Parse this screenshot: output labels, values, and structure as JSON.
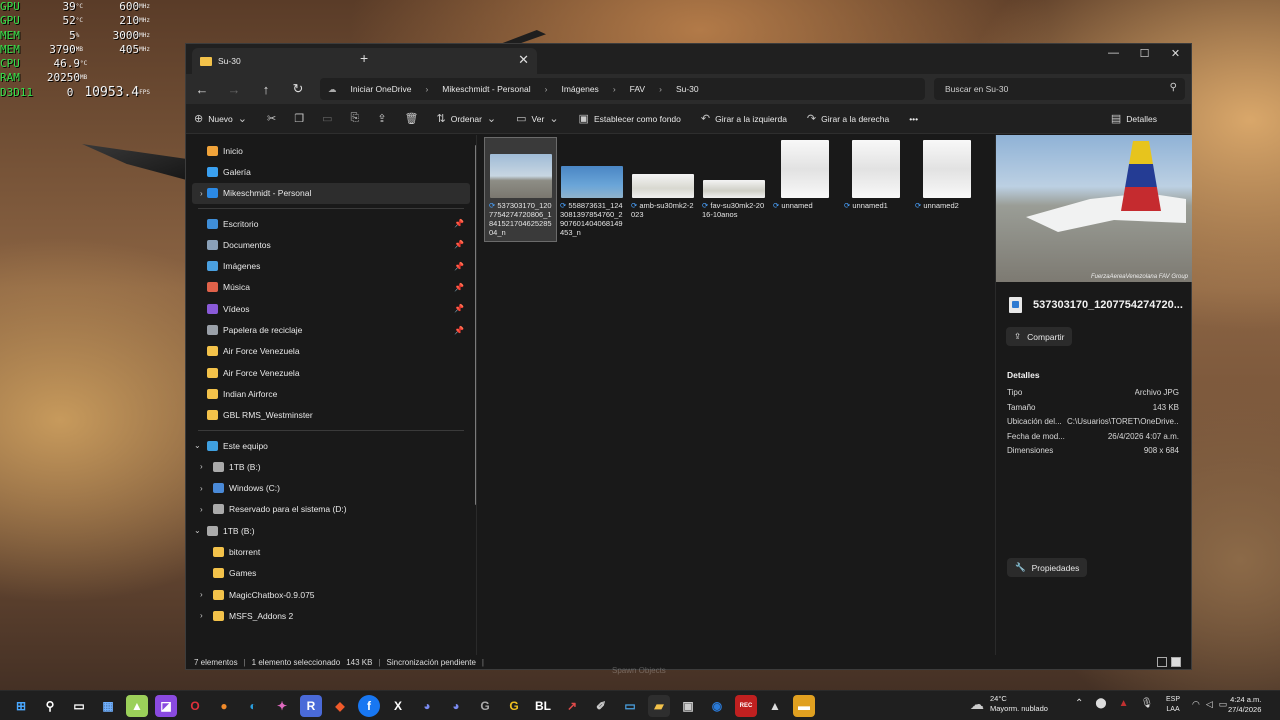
{
  "osd": {
    "rows": [
      {
        "k": "GPU",
        "v1": "39",
        "u1": "°C",
        "v2": "600",
        "u2": "MHz"
      },
      {
        "k": "GPU",
        "v1": "52",
        "u1": "°C",
        "v2": "210",
        "u2": "MHz"
      },
      {
        "k": "MEM",
        "v1": "5",
        "u1": "%",
        "v2": "3000",
        "u2": "MHz"
      },
      {
        "k": "MEM",
        "v1": "3790",
        "u1": "MB",
        "v2": "405",
        "u2": "MHz"
      },
      {
        "k": "CPU",
        "v1": "46.9",
        "u1": "°C",
        "v2": "",
        "u2": ""
      },
      {
        "k": "RAM",
        "v1": "20250",
        "u1": "MB",
        "v2": "",
        "u2": ""
      },
      {
        "k": "D3D11",
        "v1": "0",
        "u1": "",
        "v2": "10953.4",
        "u2": "FPS"
      }
    ]
  },
  "window": {
    "tab_title": "Su-30",
    "tab_close": "✕",
    "new_tab": "+",
    "controls": {
      "minimize": "—",
      "maximize": "☐",
      "close": "✕"
    }
  },
  "address": {
    "back": "←",
    "forward": "→",
    "up": "↑",
    "refresh": "↻",
    "crumbs": [
      "Iniciar OneDrive",
      "Mikeschmidt - Personal",
      "Imágenes",
      "FAV",
      "Su-30"
    ],
    "search_placeholder": "Buscar en Su-30"
  },
  "toolbar": {
    "new": "Nuevo",
    "sort": "Ordenar",
    "view": "Ver",
    "set_background": "Establecer como fondo",
    "rotate_left": "Girar a la izquierda",
    "rotate_right": "Girar a la derecha",
    "more": "•••",
    "details": "Detalles"
  },
  "sidebar": {
    "top": [
      {
        "label": "Inicio",
        "color": "#f0a33a"
      },
      {
        "label": "Galería",
        "color": "#3aa0f0"
      },
      {
        "label": "Mikeschmidt - Personal",
        "color": "#2b8ae6"
      }
    ],
    "quick": [
      {
        "label": "Escritorio",
        "color": "#3f8ed8"
      },
      {
        "label": "Documentos",
        "color": "#8aa0b8"
      },
      {
        "label": "Imágenes",
        "color": "#4aa0e0"
      },
      {
        "label": "Música",
        "color": "#e0624a"
      },
      {
        "label": "Vídeos",
        "color": "#8a5ad8"
      },
      {
        "label": "Papelera de reciclaje",
        "color": "#9aa0a8"
      },
      {
        "label": "Air Force Venezuela",
        "color": "#f3c24a"
      },
      {
        "label": "Air Force Venezuela",
        "color": "#f3c24a"
      },
      {
        "label": "Indian Airforce",
        "color": "#f3c24a"
      },
      {
        "label": "GBL RMS_Westminster",
        "color": "#f3c24a"
      }
    ],
    "tree": [
      {
        "label": "Este equipo",
        "color": "#3fa0e0"
      },
      {
        "label": "1TB (B:)",
        "color": "#aaaaaa"
      },
      {
        "label": "Windows (C:)",
        "color": "#4a8ad8"
      },
      {
        "label": "Reservado para el sistema (D:)",
        "color": "#aaaaaa"
      },
      {
        "label": "1TB (B:)",
        "color": "#aaaaaa"
      },
      {
        "label": "bitorrent",
        "color": "#f3c24a"
      },
      {
        "label": "Games",
        "color": "#f3c24a"
      },
      {
        "label": "MagicChatbox-0.9.075",
        "color": "#f3c24a"
      },
      {
        "label": "MSFS_Addons 2",
        "color": "#f3c24a"
      }
    ]
  },
  "files": [
    {
      "name": "537303170_1207754274720806_184152170462528504_n"
    },
    {
      "name": "558873631_1243081397854760_2907601404068149453_n"
    },
    {
      "name": "amb-su30mk2-2023"
    },
    {
      "name": "fav-su30mk2-2016-10anos"
    },
    {
      "name": "unnamed"
    },
    {
      "name": "unnamed1"
    },
    {
      "name": "unnamed2"
    }
  ],
  "preview": {
    "watermark": "FuerzaAereaVenezolana FAV Group",
    "filename": "537303170_1207754274720...",
    "share": "Compartir",
    "details_title": "Detalles",
    "rows": [
      {
        "k": "Tipo",
        "v": "Archivo JPG"
      },
      {
        "k": "Tamaño",
        "v": "143 KB"
      },
      {
        "k": "Ubicación del...",
        "v": "C:\\Usuarios\\TORET\\OneDrive..."
      },
      {
        "k": "Fecha de mod...",
        "v": "26/4/2026 4:07 a.m."
      },
      {
        "k": "Dimensiones",
        "v": "908 x 684"
      }
    ],
    "properties": "Propiedades"
  },
  "status": {
    "count": "7 elementos",
    "selected": "1 elemento seleccionado",
    "size": "143 KB",
    "sync": "Sincronización pendiente"
  },
  "ghost_text": "Spawn Objects",
  "taskbar": {
    "weather_temp": "24°C",
    "weather_desc": "Mayorm. nublado",
    "lang1": "ESP",
    "lang2": "LAA",
    "time": "4:24 a.m.",
    "date": "27/4/2026"
  }
}
